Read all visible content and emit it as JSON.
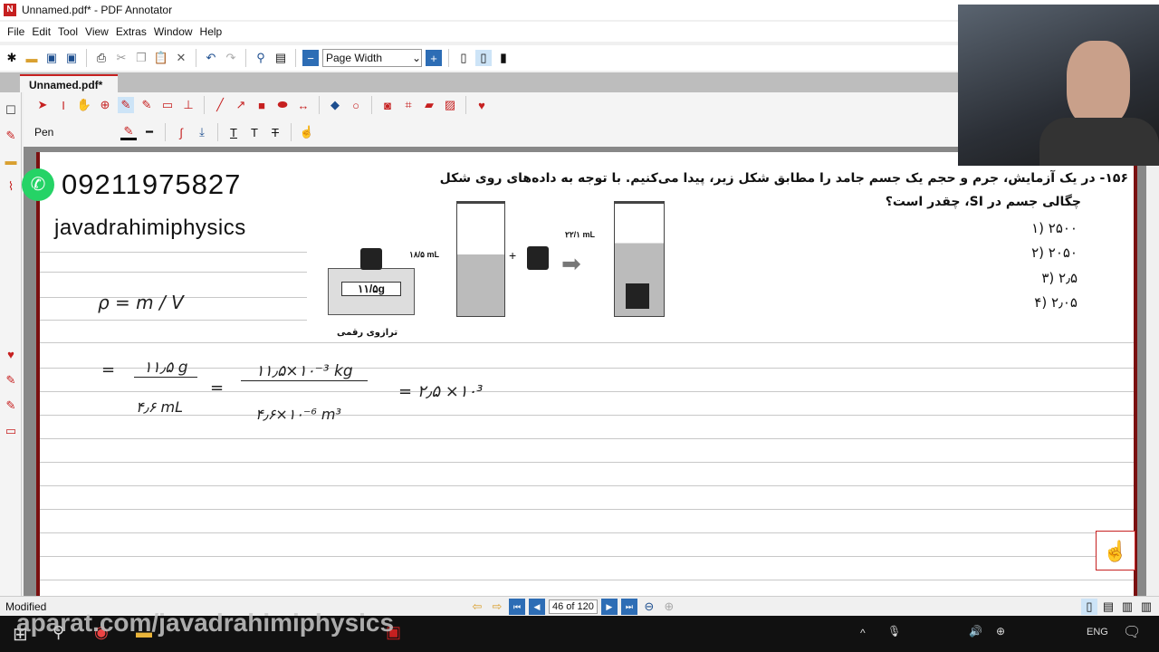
{
  "window": {
    "title": "Unnamed.pdf* - PDF Annotator"
  },
  "menu": [
    "File",
    "Edit",
    "Tool",
    "View",
    "Extras",
    "Window",
    "Help"
  ],
  "toolbar": {
    "zoom_mode": "Page Width"
  },
  "tab": {
    "label": "Unnamed.pdf*"
  },
  "annotation_toolbar": {
    "tool_name": "Pen"
  },
  "page": {
    "phone": "09211975827",
    "channel": "javadrahimiphysics",
    "question_line1": "۱۵۶- در یک آزمایش، جرم و حجم یک جسم جامد را مطابق شکل زیر، پیدا می‌کنیم. با توجه به داده‌های روی شکل",
    "question_line2": "چگالی جسم در SI، چقدر است؟",
    "options": [
      "۲۵۰۰ (۱",
      "۲۰۵۰ (۲",
      "۲٫۵ (۳",
      "۲٫۰۵ (۴"
    ],
    "figure": {
      "mass": "۱۱/۵g",
      "object_label": "جسم",
      "balance_label": "ترازوی رقمی",
      "vol1": "۱۸/۵ mL",
      "vol2": "۲۲/۱ mL",
      "plus": "+"
    },
    "handwriting": {
      "formula": "ρ = m / V",
      "step1_num": "۱۱٫۵ g",
      "step1_den": "۴٫۶ mL",
      "step2_num": "۱۱٫۵×۱۰⁻³ kg",
      "step2_den": "۴٫۶×۱۰⁻⁶ m³",
      "result": "= ۲٫۵ ×۱۰³"
    }
  },
  "status": {
    "text": "Modified",
    "page_indicator": "46 of 120"
  },
  "taskbar": {
    "language": "ENG",
    "watermark": "aparat.com/javadrahimiphysics"
  },
  "colors": {
    "accent": "#c62020",
    "page_border": "#7a1010"
  }
}
